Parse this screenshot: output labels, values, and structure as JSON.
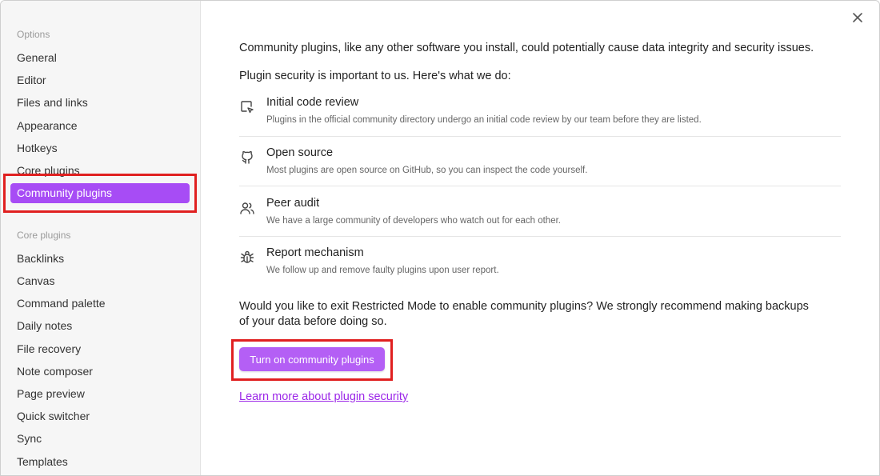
{
  "sidebar": {
    "options_title": "Options",
    "options_items": [
      {
        "label": "General"
      },
      {
        "label": "Editor"
      },
      {
        "label": "Files and links"
      },
      {
        "label": "Appearance"
      },
      {
        "label": "Hotkeys"
      },
      {
        "label": "Core plugins"
      },
      {
        "label": "Community plugins",
        "active": true
      }
    ],
    "core_title": "Core plugins",
    "core_items": [
      {
        "label": "Backlinks"
      },
      {
        "label": "Canvas"
      },
      {
        "label": "Command palette"
      },
      {
        "label": "Daily notes"
      },
      {
        "label": "File recovery"
      },
      {
        "label": "Note composer"
      },
      {
        "label": "Page preview"
      },
      {
        "label": "Quick switcher"
      },
      {
        "label": "Sync"
      },
      {
        "label": "Templates"
      }
    ]
  },
  "main": {
    "intro": "Community plugins, like any other software you install, could potentially cause data integrity and security issues.",
    "security_heading": "Plugin security is important to us. Here's what we do:",
    "features": [
      {
        "icon": "code-review-icon",
        "title": "Initial code review",
        "desc": "Plugins in the official community directory undergo an initial code review by our team before they are listed."
      },
      {
        "icon": "github-icon",
        "title": "Open source",
        "desc": "Most plugins are open source on GitHub, so you can inspect the code yourself."
      },
      {
        "icon": "users-icon",
        "title": "Peer audit",
        "desc": "We have a large community of developers who watch out for each other."
      },
      {
        "icon": "bug-icon",
        "title": "Report mechanism",
        "desc": "We follow up and remove faulty plugins upon user report."
      }
    ],
    "question_line1": "Would you like to exit Restricted Mode to enable community plugins? We strongly recommend making backups",
    "question_line2": "of your data before doing so.",
    "button_label": "Turn on community plugins",
    "link_label": "Learn more about plugin security"
  },
  "colors": {
    "accent": "#a74cf5",
    "button": "#b45ff5",
    "link": "#9c27e8",
    "highlight": "#e02020"
  }
}
